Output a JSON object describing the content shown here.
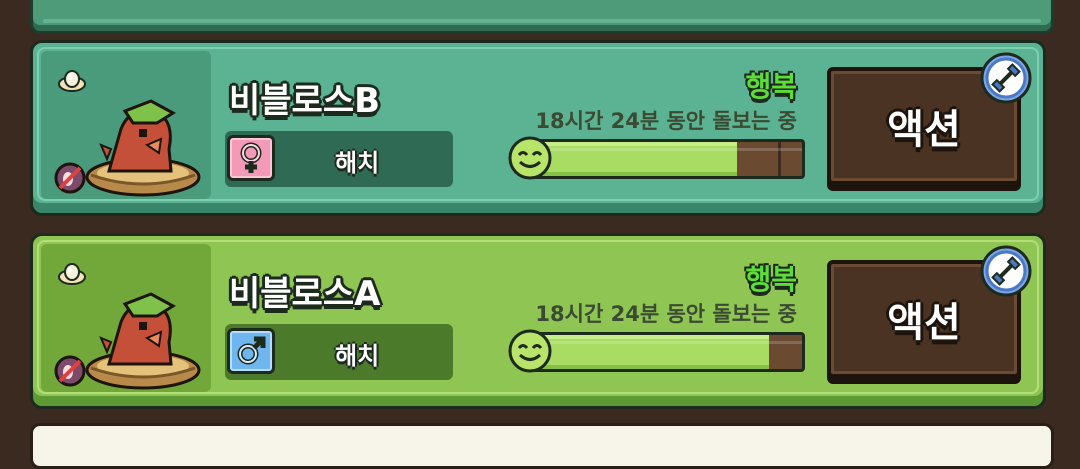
{
  "cards": [
    {
      "name": "비블로스B",
      "gender": "female",
      "gender_symbol": "♀",
      "stage": "해치",
      "mood": "행복",
      "care_time": "18시간 24분 동안 돌보는 중",
      "happiness": 0.76,
      "action_label": "액션",
      "theme": "teal",
      "icons": [
        "egg-icon",
        "nest-dino-icon",
        "no-breed-icon",
        "female-icon",
        "smiley-icon",
        "dumbbell-icon"
      ]
    },
    {
      "name": "비블로스A",
      "gender": "male",
      "gender_symbol": "♂",
      "stage": "해치",
      "mood": "행복",
      "care_time": "18시간 24분 동안 돌보는 중",
      "happiness": 0.88,
      "action_label": "액션",
      "theme": "lime",
      "icons": [
        "egg-icon",
        "nest-dino-icon",
        "no-breed-icon",
        "male-icon",
        "smiley-icon",
        "dumbbell-icon"
      ]
    }
  ],
  "colors": {
    "background": "#3a2a1f",
    "teal_card": "#5cb393",
    "lime_card": "#8fc552",
    "mood_green": "#5ddc3a",
    "bar_fill": "#a8dc62",
    "action_button": "#4a3323"
  }
}
